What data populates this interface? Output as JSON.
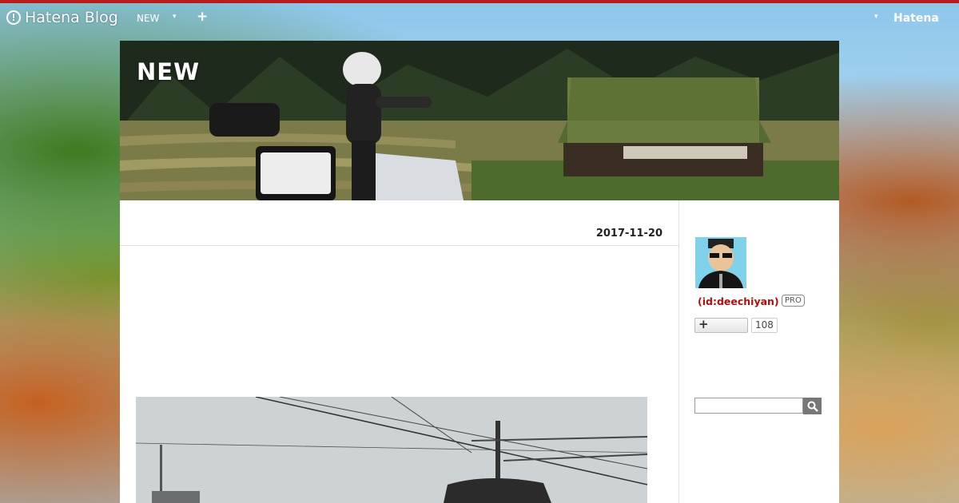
{
  "globalbar": {
    "logo_text": "Hatena Blog",
    "blog_name": "NEW",
    "dropdown_caret": "▾",
    "plus": "+",
    "right_caret": "▾",
    "hatena_label": "Hatena"
  },
  "header": {
    "title": "NEW"
  },
  "entry": {
    "date": "2017-11-20"
  },
  "sidebar": {
    "user_id": "(id:deechiyan)",
    "pro_badge": "PRO",
    "follow_plus": "+",
    "follow_count": "108",
    "search_placeholder": ""
  },
  "colors": {
    "top_stripe": "#b81d1d",
    "user_id": "#b40d0d"
  },
  "icons": [
    "hatena-logo-icon",
    "caret-down-icon",
    "plus-icon",
    "search-icon"
  ]
}
